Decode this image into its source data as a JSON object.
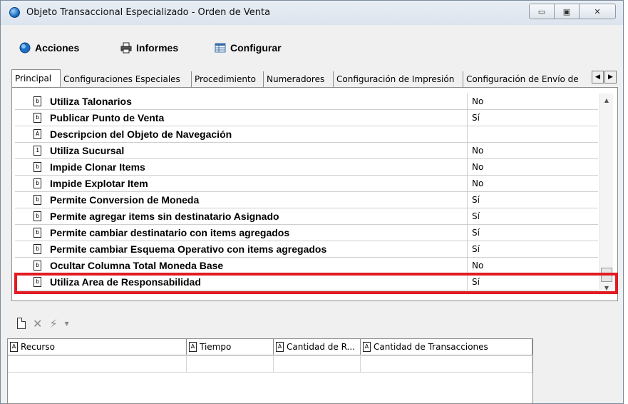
{
  "window": {
    "title": "Objeto Transaccional Especializado - Orden de Venta",
    "controls": {
      "minimize": "▭",
      "maximize": "▣",
      "close": "✕"
    }
  },
  "menu": {
    "items": [
      {
        "label": "Acciones",
        "icon": "globe-icon"
      },
      {
        "label": "Informes",
        "icon": "printer-icon"
      },
      {
        "label": "Configurar",
        "icon": "table-icon"
      }
    ]
  },
  "tabs": [
    {
      "label": "Principal",
      "active": true
    },
    {
      "label": "Configuraciones Especiales"
    },
    {
      "label": "Procedimiento"
    },
    {
      "label": "Numeradores"
    },
    {
      "label": "Configuración de Impresión"
    },
    {
      "label": "Configuración de Envío de"
    }
  ],
  "tab_scroll": {
    "left": "◀",
    "right": "▶"
  },
  "properties": [
    {
      "icon": "b",
      "label": "Utiliza Talonarios",
      "value": "No"
    },
    {
      "icon": "b",
      "label": "Publicar Punto de Venta",
      "value": "Sí"
    },
    {
      "icon": "A",
      "label": "Descripcion del Objeto de  Navegación",
      "value": ""
    },
    {
      "icon": "1",
      "label": "Utiliza Sucursal",
      "value": "No"
    },
    {
      "icon": "b",
      "label": "Impide Clonar Items",
      "value": "No"
    },
    {
      "icon": "b",
      "label": "Impide Explotar Item",
      "value": "No"
    },
    {
      "icon": "b",
      "label": "Permite Conversion de Moneda",
      "value": "Sí"
    },
    {
      "icon": "b",
      "label": "Permite agregar items sin destinatario Asignado",
      "value": "Sí"
    },
    {
      "icon": "b",
      "label": "Permite cambiar destinatario con items agregados",
      "value": "Sí"
    },
    {
      "icon": "b",
      "label": "Permite cambiar Esquema Operativo con items agregados",
      "value": "Sí"
    },
    {
      "icon": "b",
      "label": "Ocultar Columna Total Moneda Base",
      "value": "No"
    },
    {
      "icon": "b",
      "label": "Utiliza Area de Responsabilidad",
      "value": "Sí"
    }
  ],
  "scroll_arrows": {
    "up": "▲",
    "down": "▼"
  },
  "highlight_color": "#e11b22",
  "lower_toolbar": {
    "delete": "✕",
    "wand": "⚡",
    "dropdown": "▾"
  },
  "resource_table": {
    "columns": [
      {
        "icon": "A",
        "label": "Recurso"
      },
      {
        "icon": "A",
        "label": "Tiempo"
      },
      {
        "icon": "A",
        "label": "Cantidad de R..."
      },
      {
        "icon": "A",
        "label": "Cantidad de Transacciones"
      }
    ]
  }
}
